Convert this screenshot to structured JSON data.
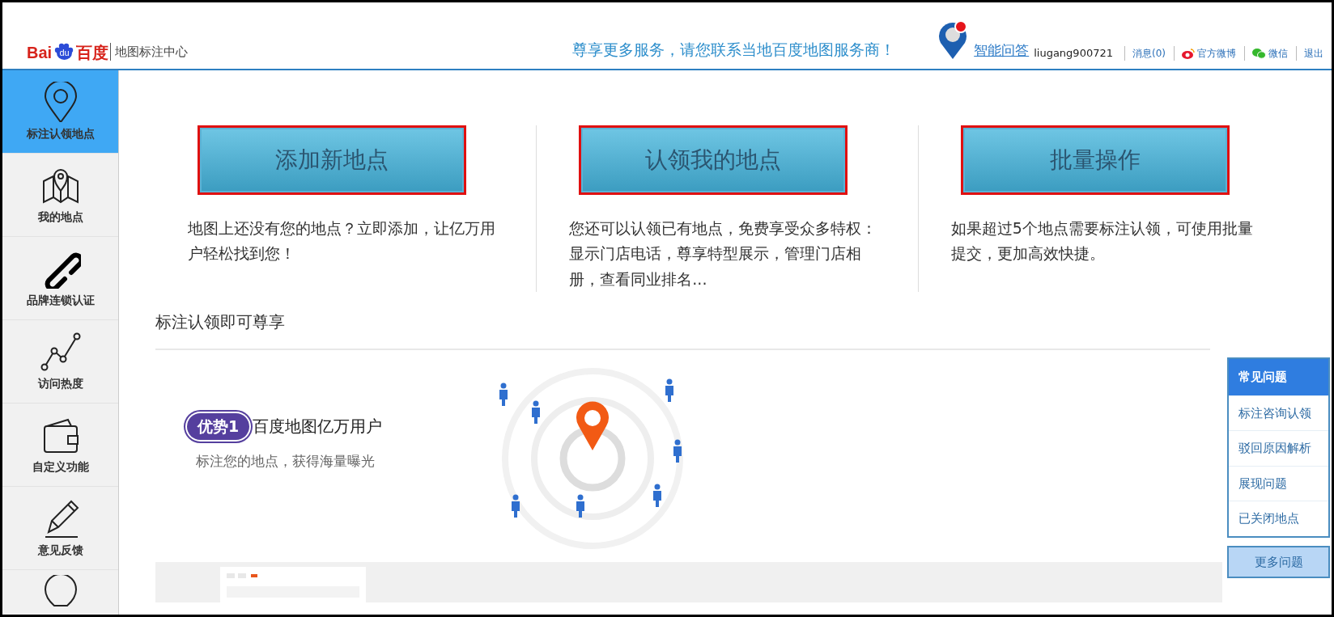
{
  "header": {
    "logo": {
      "left": "Bai",
      "paw": "du",
      "right": "百度"
    },
    "site_name": "地图标注中心",
    "slogan": "尊享更多服务，请您联系当地百度地图服务商！",
    "assistant": "智能问答",
    "username": "liugang900721",
    "links": [
      {
        "label": "消息(0)",
        "kind": "text"
      },
      {
        "label": "官方微博",
        "kind": "weibo"
      },
      {
        "label": "微信",
        "kind": "wechat"
      },
      {
        "label": "退出",
        "kind": "text"
      }
    ]
  },
  "sidebar": {
    "items": [
      {
        "label": "标注认领地点",
        "selected": true
      },
      {
        "label": "我的地点",
        "selected": false
      },
      {
        "label": "品牌连锁认证",
        "selected": false
      },
      {
        "label": "访问热度",
        "selected": false
      },
      {
        "label": "自定义功能",
        "selected": false
      },
      {
        "label": "意见反馈",
        "selected": false
      },
      {
        "selected": false
      }
    ]
  },
  "actions": [
    {
      "button": "添加新地点",
      "description": "地图上还没有您的地点？立即添加，让亿万用户轻松找到您！"
    },
    {
      "button": "认领我的地点",
      "description": "您还可以认领已有地点，免费享受众多特权：显示门店电话，尊享特型展示，管理门店相册，查看同业排名..."
    },
    {
      "button": "批量操作",
      "description": "如果超过5个地点需要标注认领，可使用批量提交，更加高效快捷。"
    }
  ],
  "benefits": {
    "title": "标注认领即可尊享",
    "advantage": {
      "badge": "优势1",
      "title": "百度地图亿万用户",
      "description": "标注您的地点，获得海量曝光"
    }
  },
  "faq": {
    "title": "常见问题",
    "items": [
      "标注咨询认领",
      "驳回原因解析",
      "展现问题",
      "已关闭地点"
    ],
    "more": "更多问题"
  }
}
